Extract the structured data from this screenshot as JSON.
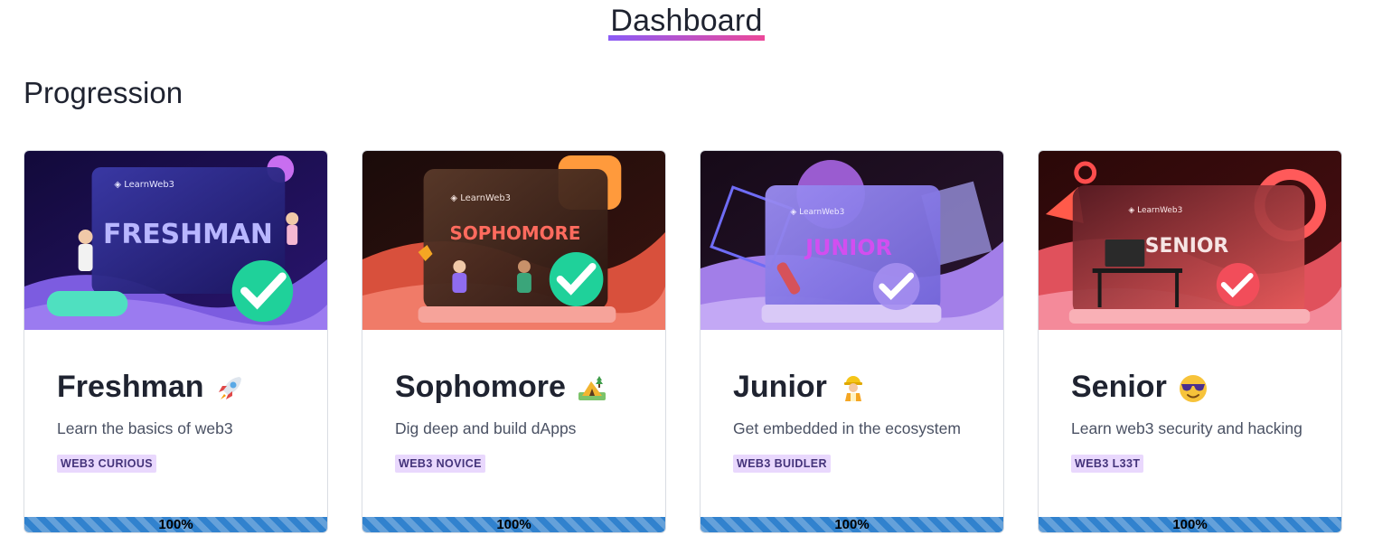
{
  "header": {
    "title": "Dashboard"
  },
  "section": {
    "title": "Progression"
  },
  "cards": [
    {
      "title": "Freshman",
      "emoji": "rocket-icon",
      "description": "Learn the basics of web3",
      "badge": "WEB3 CURIOUS",
      "progress_label": "100%",
      "progress": 1.0,
      "banner_text": "FRESHMAN",
      "banner_brand": "LearnWeb3"
    },
    {
      "title": "Sophomore",
      "emoji": "camping-icon",
      "description": "Dig deep and build dApps",
      "badge": "WEB3 NOVICE",
      "progress_label": "100%",
      "progress": 1.0,
      "banner_text": "SOPHOMORE",
      "banner_brand": "LearnWeb3"
    },
    {
      "title": "Junior",
      "emoji": "construction-worker-icon",
      "description": "Get embedded in the ecosystem",
      "badge": "WEB3 BUIDLER",
      "progress_label": "100%",
      "progress": 1.0,
      "banner_text": "JUNIOR",
      "banner_brand": "LearnWeb3"
    },
    {
      "title": "Senior",
      "emoji": "sunglasses-face-icon",
      "description": "Learn web3 security and hacking",
      "badge": "WEB3 L33T",
      "progress_label": "100%",
      "progress": 1.0,
      "banner_text": "SENIOR",
      "banner_brand": "LearnWeb3"
    }
  ],
  "colors": {
    "accent_gradient_start": "#8b5cf6",
    "accent_gradient_end": "#ec4899",
    "badge_bg": "#e9d8fd",
    "badge_text": "#44337a",
    "progress_fill": "#3182ce"
  }
}
